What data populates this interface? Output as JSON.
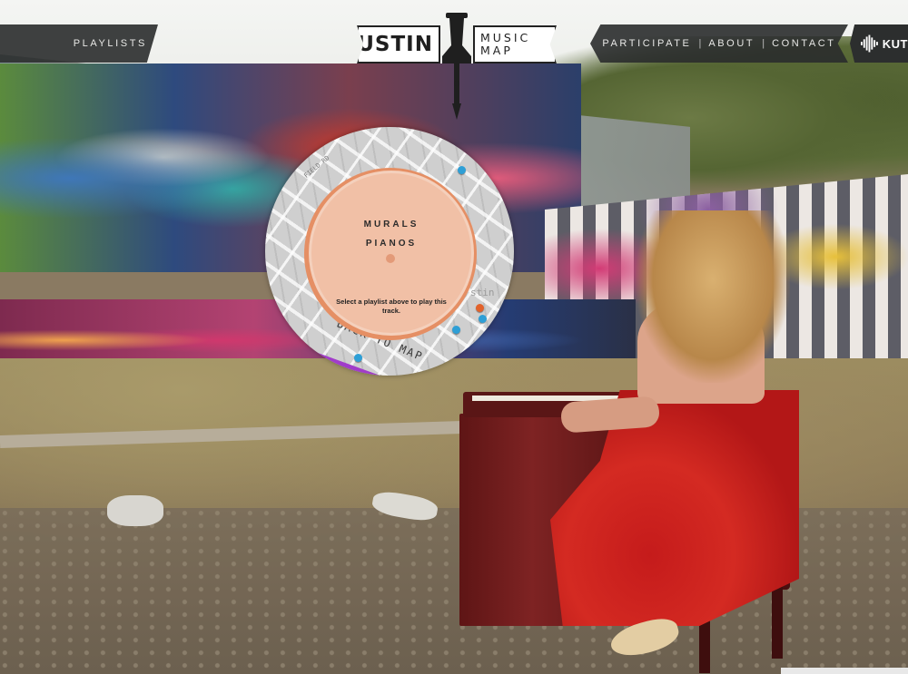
{
  "nav": {
    "left_label": "PLAYLISTS",
    "right_items": [
      "PARTICIPATE",
      "ABOUT",
      "CONTACT"
    ],
    "separator": "|"
  },
  "brand": {
    "word1": "AUSTIN",
    "word2": "MUSIC",
    "word3": "MAP"
  },
  "sponsor": {
    "label": "KUT"
  },
  "player": {
    "title": "MURALS",
    "subtitle": "PIANOS",
    "message": "Select a playlist above to play this track.",
    "back_label": "BACK TO MAP",
    "street_1": "FIELD RD",
    "street_2": "stin"
  },
  "colors": {
    "bar_bg": "#2a2c2c",
    "disc": "#f1c0a6",
    "disc_edge": "#e58f64",
    "road": "#a13cc9",
    "marker_blue": "#2e9fd6",
    "marker_orange": "#e2622b"
  }
}
